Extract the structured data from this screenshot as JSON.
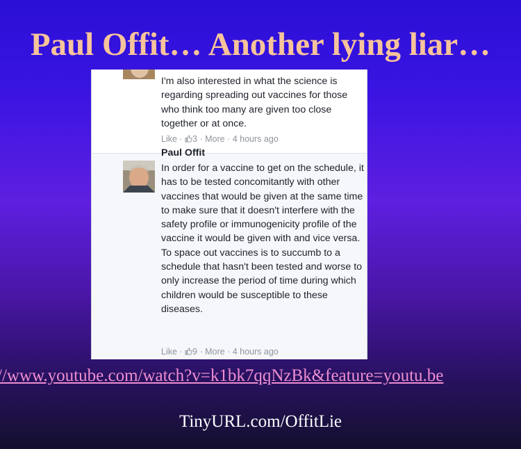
{
  "slide": {
    "title": "Paul Offit… Another lying liar…",
    "link": "//www.youtube.com/watch?v=k1bk7qqNzBk&feature=youtu.be",
    "short_url": "TinyURL.com/OffitLie"
  },
  "comments": [
    {
      "author": "",
      "text": "I'm also interested in what the science is regarding spreading out vaccines for those who think too many are given too close together or at once.",
      "like_label": "Like",
      "like_count": "3",
      "more_label": "More",
      "time": "4 hours ago"
    },
    {
      "author": "Paul Offit",
      "text": "In order for a vaccine to get on the schedule, it has to be tested concomitantly with other vaccines that would be given at the same time to make sure that it doesn't interfere with the safety profile or immunogenicity profile of the vaccine it would be given with and vice versa. To space out vaccines is to succumb to a schedule that hasn't been tested and worse to only increase the period of time during which children would be susceptible to these diseases.",
      "like_label": "Like",
      "like_count": "9",
      "more_label": "More",
      "time": "4 hours ago"
    }
  ],
  "colors": {
    "title": "#f7c39b",
    "link": "#ee8ed0",
    "background_top": "#2a0fd6",
    "background_bottom": "#14102e"
  }
}
